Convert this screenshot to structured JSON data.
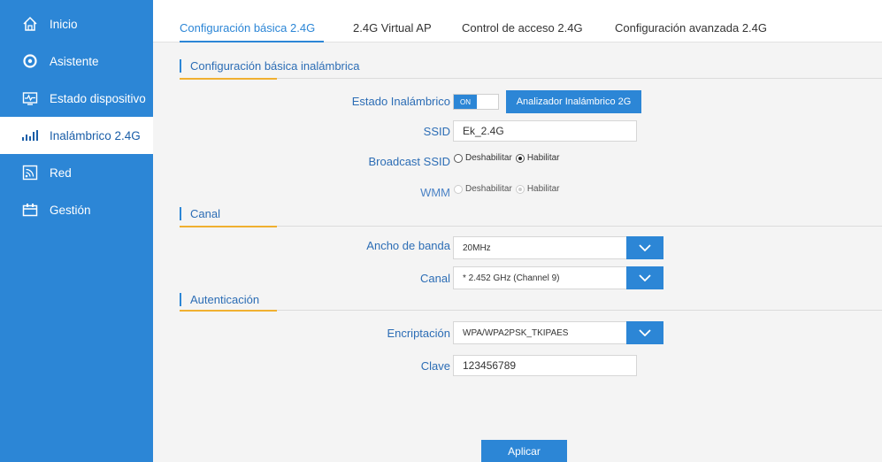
{
  "sidebar": {
    "items": [
      {
        "label": "Inicio",
        "icon": "home-icon"
      },
      {
        "label": "Asistente",
        "icon": "wizard-icon"
      },
      {
        "label": "Estado dispositivo",
        "icon": "status-icon"
      },
      {
        "label": "Inalámbrico 2.4G",
        "icon": "signal-bars-icon",
        "active": true
      },
      {
        "label": "Red",
        "icon": "network-icon"
      },
      {
        "label": "Gestión",
        "icon": "management-icon"
      }
    ]
  },
  "tabs": [
    {
      "label": "Configuración básica 2.4G",
      "active": true
    },
    {
      "label": "2.4G Virtual AP"
    },
    {
      "label": "Control de acceso 2.4G"
    },
    {
      "label": "Configuración avanzada 2.4G"
    }
  ],
  "sections": {
    "basic": "Configuración básica inalámbrica",
    "channel": "Canal",
    "auth": "Autenticación"
  },
  "form": {
    "wireless_state": {
      "label": "Estado Inalámbrico",
      "toggle": "ON",
      "analyzer_button": "Analizador Inalámbrico 2G"
    },
    "ssid": {
      "label": "SSID",
      "value": "Ek_2.4G"
    },
    "broadcast": {
      "label": "Broadcast SSID",
      "option_disable": "Deshabilitar",
      "option_enable": "Habilitar",
      "selected": "Habilitar"
    },
    "wmm": {
      "label": "WMM",
      "option_disable": "Deshabilitar",
      "option_enable": "Habilitar",
      "selected": "Habilitar"
    },
    "bandwidth": {
      "label": "Ancho de banda",
      "value": "20MHz"
    },
    "channel": {
      "label": "Canal",
      "value": "* 2.452 GHz (Channel 9)"
    },
    "encryption": {
      "label": "Encriptación",
      "value": "WPA/WPA2PSK_TKIPAES"
    },
    "key": {
      "label": "Clave",
      "value": "123456789"
    },
    "apply_button": "Aplicar"
  },
  "colors": {
    "primary": "#2c86d6",
    "accent": "#f0b030",
    "label": "#2c6db5"
  }
}
